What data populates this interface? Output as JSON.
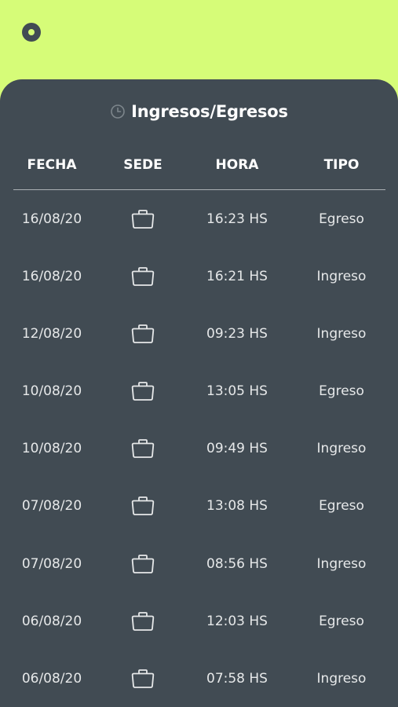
{
  "header": {
    "menu_button": "dot-button"
  },
  "panel": {
    "title": "Ingresos/Egresos",
    "title_icon": "clock-icon"
  },
  "table": {
    "columns": [
      "FECHA",
      "SEDE",
      "HORA",
      "TIPO"
    ],
    "sede_icon": "briefcase-icon",
    "rows": [
      {
        "fecha": "16/08/20",
        "hora": "16:23 HS",
        "tipo": "Egreso"
      },
      {
        "fecha": "16/08/20",
        "hora": "16:21 HS",
        "tipo": "Ingreso"
      },
      {
        "fecha": "12/08/20",
        "hora": "09:23 HS",
        "tipo": "Ingreso"
      },
      {
        "fecha": "10/08/20",
        "hora": "13:05 HS",
        "tipo": "Egreso"
      },
      {
        "fecha": "10/08/20",
        "hora": "09:49 HS",
        "tipo": "Ingreso"
      },
      {
        "fecha": "07/08/20",
        "hora": "13:08 HS",
        "tipo": "Egreso"
      },
      {
        "fecha": "07/08/20",
        "hora": "08:56 HS",
        "tipo": "Ingreso"
      },
      {
        "fecha": "06/08/20",
        "hora": "12:03 HS",
        "tipo": "Egreso"
      },
      {
        "fecha": "06/08/20",
        "hora": "07:58 HS",
        "tipo": "Ingreso"
      }
    ]
  },
  "colors": {
    "background_accent": "#d6fc78",
    "panel": "#414b53",
    "text": "#ffffff"
  }
}
